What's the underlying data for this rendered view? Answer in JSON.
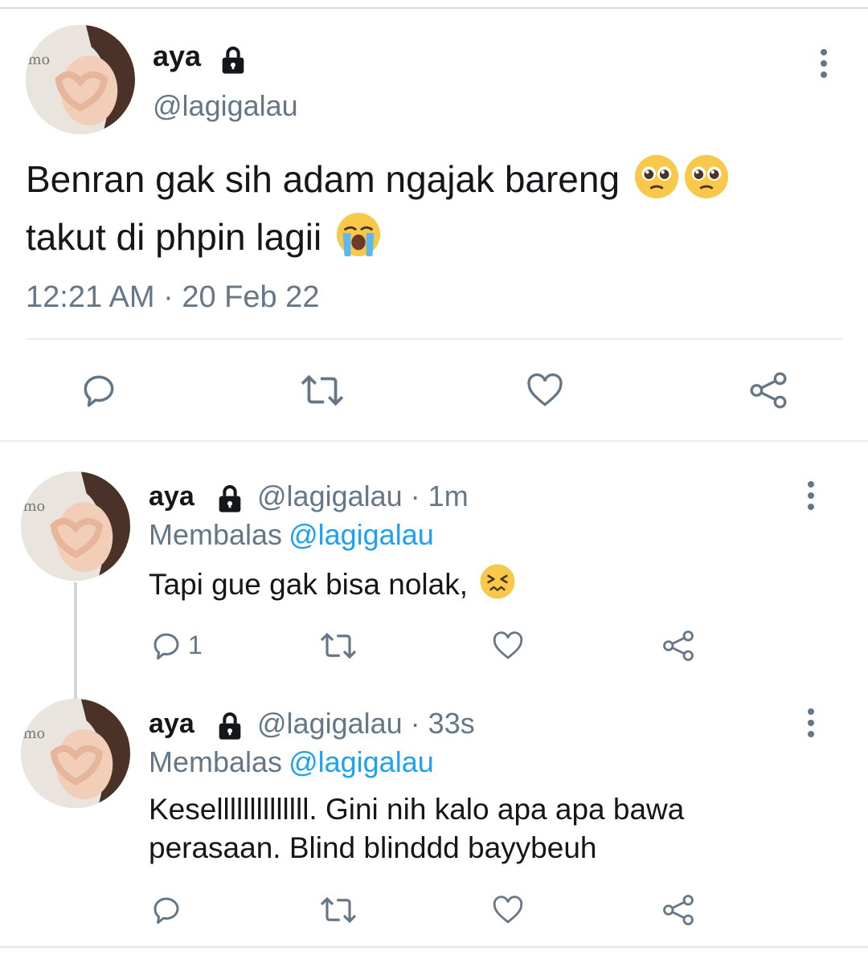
{
  "main_tweet": {
    "name": "aya",
    "handle": "@lagigalau",
    "text": "Benran gak sih adam ngajak bareng",
    "text_line2": "takut di phpin lagii",
    "emojis": [
      "pleading-face-emoji",
      "pleading-face-emoji",
      "loudly-crying-face-emoji"
    ],
    "timestamp": "12:21 AM · 20 Feb 22"
  },
  "replies": [
    {
      "name": "aya",
      "handle": "@lagigalau",
      "age": "1m",
      "replying_label": "Membalas",
      "replying_to": "@lagigalau",
      "text": "Tapi gue gak bisa nolak,",
      "emoji": "confounded-face-emoji",
      "reply_count": "1"
    },
    {
      "name": "aya",
      "handle": "@lagigalau",
      "age": "33s",
      "replying_label": "Membalas",
      "replying_to": "@lagigalau",
      "text_line1": "Kesellllllllllllll. Gini nih kalo apa apa bawa",
      "text_line2": "perasaan. Blind blinddd bayybeuh",
      "reply_count": ""
    }
  ],
  "colors": {
    "text": "#14171a",
    "secondary": "#657786",
    "link": "#1da1f2",
    "divider": "#e6ecf0"
  }
}
